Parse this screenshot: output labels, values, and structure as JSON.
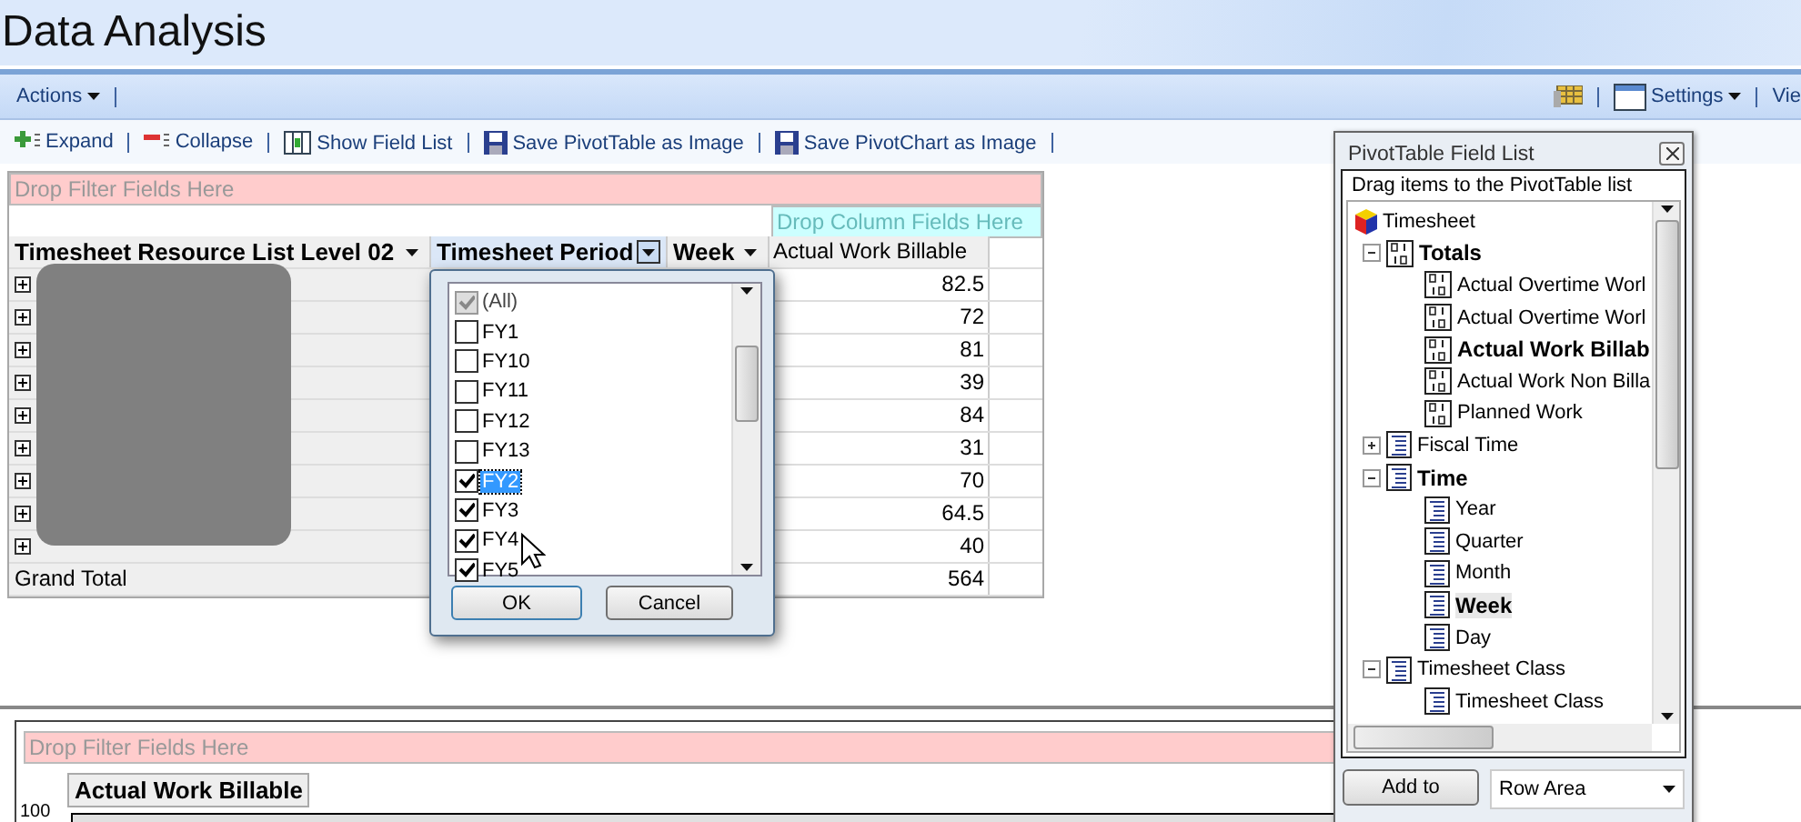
{
  "page_title": "Data Analysis",
  "menu_bar": {
    "left": [
      {
        "label": "Actions",
        "dropdown": true
      }
    ],
    "right": [
      {
        "kind": "icon"
      },
      {
        "kind": "text",
        "label": "Settings",
        "dropdown": true
      },
      {
        "kind": "text",
        "label": "Vie",
        "dropdown": false
      }
    ]
  },
  "toolbar": [
    {
      "label": "Expand",
      "kind": "expand"
    },
    {
      "label": "Collapse",
      "kind": "collapse"
    },
    {
      "label": "Show Field List",
      "kind": "fields"
    },
    {
      "label": "Save PivotTable as Image",
      "kind": "save"
    },
    {
      "label": "Save PivotChart as Image",
      "kind": "save"
    }
  ],
  "pivot_table": {
    "filter_drop": "Drop Filter Fields Here",
    "column_drop": "Drop Column Fields Here",
    "headers": [
      {
        "label": "Timesheet Resource List Level 02",
        "active": false
      },
      {
        "label": "Timesheet Period",
        "active": true
      },
      {
        "label": "Week",
        "active": false
      },
      {
        "label": "Actual Work Billable",
        "active": false
      }
    ],
    "rows": [
      {
        "value": "82.5"
      },
      {
        "value": "72"
      },
      {
        "value": "81"
      },
      {
        "value": "39"
      },
      {
        "value": "84"
      },
      {
        "value": "31"
      },
      {
        "value": "70"
      },
      {
        "value": "64.5"
      },
      {
        "value": "40"
      }
    ],
    "grand_total": {
      "label": "Grand Total",
      "value": "564"
    }
  },
  "filter_dropdown": {
    "items": [
      {
        "label": "(All)",
        "checked": true,
        "partial": true,
        "selected": false
      },
      {
        "label": "FY1",
        "checked": false,
        "partial": false,
        "selected": false
      },
      {
        "label": "FY10",
        "checked": false,
        "partial": false,
        "selected": false
      },
      {
        "label": "FY11",
        "checked": false,
        "partial": false,
        "selected": false
      },
      {
        "label": "FY12",
        "checked": false,
        "partial": false,
        "selected": false
      },
      {
        "label": "FY13",
        "checked": false,
        "partial": false,
        "selected": false
      },
      {
        "label": "FY2",
        "checked": true,
        "partial": false,
        "selected": true
      },
      {
        "label": "FY3",
        "checked": true,
        "partial": false,
        "selected": false
      },
      {
        "label": "FY4",
        "checked": true,
        "partial": false,
        "selected": false
      },
      {
        "label": "FY5",
        "checked": true,
        "partial": false,
        "selected": false
      }
    ],
    "buttons": [
      "OK",
      "Cancel"
    ]
  },
  "pivot_chart": {
    "filter_drop": "Drop Filter Fields Here",
    "data_field": "Actual Work Billable",
    "y_tick": "100"
  },
  "field_list": {
    "title": "PivotTable Field List",
    "hint": "Drag items to the PivotTable list",
    "tree": [
      {
        "label": "Timesheet",
        "kind": "cube",
        "in_use": false,
        "selected": false,
        "children": [
          {
            "label": "Totals",
            "kind": "measure",
            "in_use": true,
            "selected": false,
            "expanded": true,
            "children": [
              {
                "label": "Actual Overtime Worl",
                "kind": "measure",
                "in_use": false,
                "selected": false
              },
              {
                "label": "Actual Overtime Worl",
                "kind": "measure",
                "in_use": false,
                "selected": false
              },
              {
                "label": "Actual Work Billab",
                "kind": "measure",
                "in_use": true,
                "selected": false
              },
              {
                "label": "Actual Work Non Billa",
                "kind": "measure",
                "in_use": false,
                "selected": false
              },
              {
                "label": "Planned Work",
                "kind": "measure",
                "in_use": false,
                "selected": false
              }
            ]
          },
          {
            "label": "Fiscal Time",
            "kind": "dimension",
            "in_use": false,
            "selected": false,
            "expanded": false
          },
          {
            "label": "Time",
            "kind": "dimension",
            "in_use": true,
            "selected": false,
            "expanded": true,
            "children": [
              {
                "label": "Year",
                "kind": "dimension",
                "in_use": false,
                "selected": false
              },
              {
                "label": "Quarter",
                "kind": "dimension",
                "in_use": false,
                "selected": false
              },
              {
                "label": "Month",
                "kind": "dimension",
                "in_use": false,
                "selected": false
              },
              {
                "label": "Week",
                "kind": "dimension",
                "in_use": true,
                "selected": true
              },
              {
                "label": "Day",
                "kind": "dimension",
                "in_use": false,
                "selected": false
              }
            ]
          },
          {
            "label": "Timesheet Class",
            "kind": "dimension",
            "in_use": false,
            "selected": false,
            "expanded": true,
            "children": [
              {
                "label": "Timesheet Class",
                "kind": "dimension",
                "in_use": false,
                "selected": false
              }
            ]
          }
        ]
      }
    ],
    "add_button": "Add to",
    "area_select": "Row Area"
  }
}
